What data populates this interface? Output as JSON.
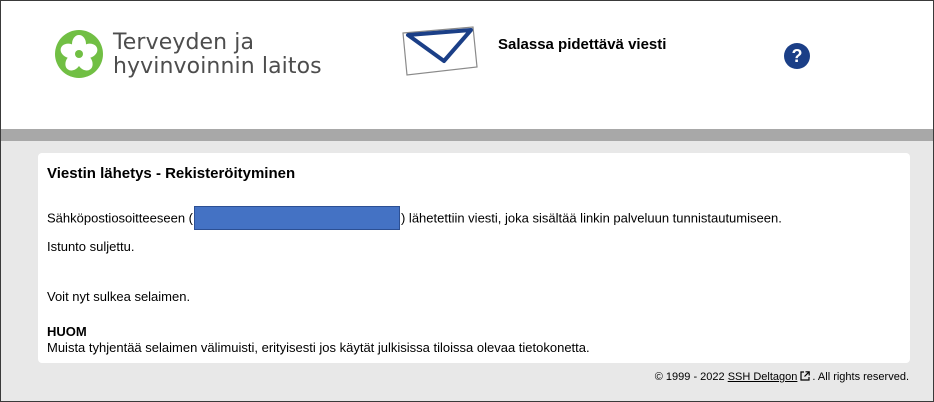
{
  "header": {
    "org_name_line1": "Terveyden ja",
    "org_name_line2": "hyvinvoinnin laitos",
    "secure_title": "Salassa pidettävä viesti",
    "help_symbol": "?",
    "logo_icon": "flower-logo-icon",
    "envelope_icon": "envelope-icon",
    "colors": {
      "logo_green": "#71bf44",
      "help_blue": "#1b3f87",
      "envelope_blue": "#1b3f87"
    }
  },
  "card": {
    "title": "Viestin lähetys - Rekisteröityminen",
    "line1_prefix": "Sähköpostiosoitteeseen (",
    "line1_suffix": ") lähetettiin viesti, joka sisältää linkin palveluun tunnistautumiseen.",
    "session_closed": "Istunto suljettu.",
    "close_browser": "Voit nyt sulkea selaimen.",
    "notice_heading": "HUOM",
    "notice_text": "Muista tyhjentää selaimen välimuisti, erityisesti jos käytät julkisissa tiloissa olevaa tietokonetta.",
    "redaction_color": "#4472c4"
  },
  "footer": {
    "copyright": "© 1999 - 2022 ",
    "link_text": "SSH Deltagon",
    "rights": ". All rights reserved.",
    "external_icon": "external-link-icon"
  }
}
